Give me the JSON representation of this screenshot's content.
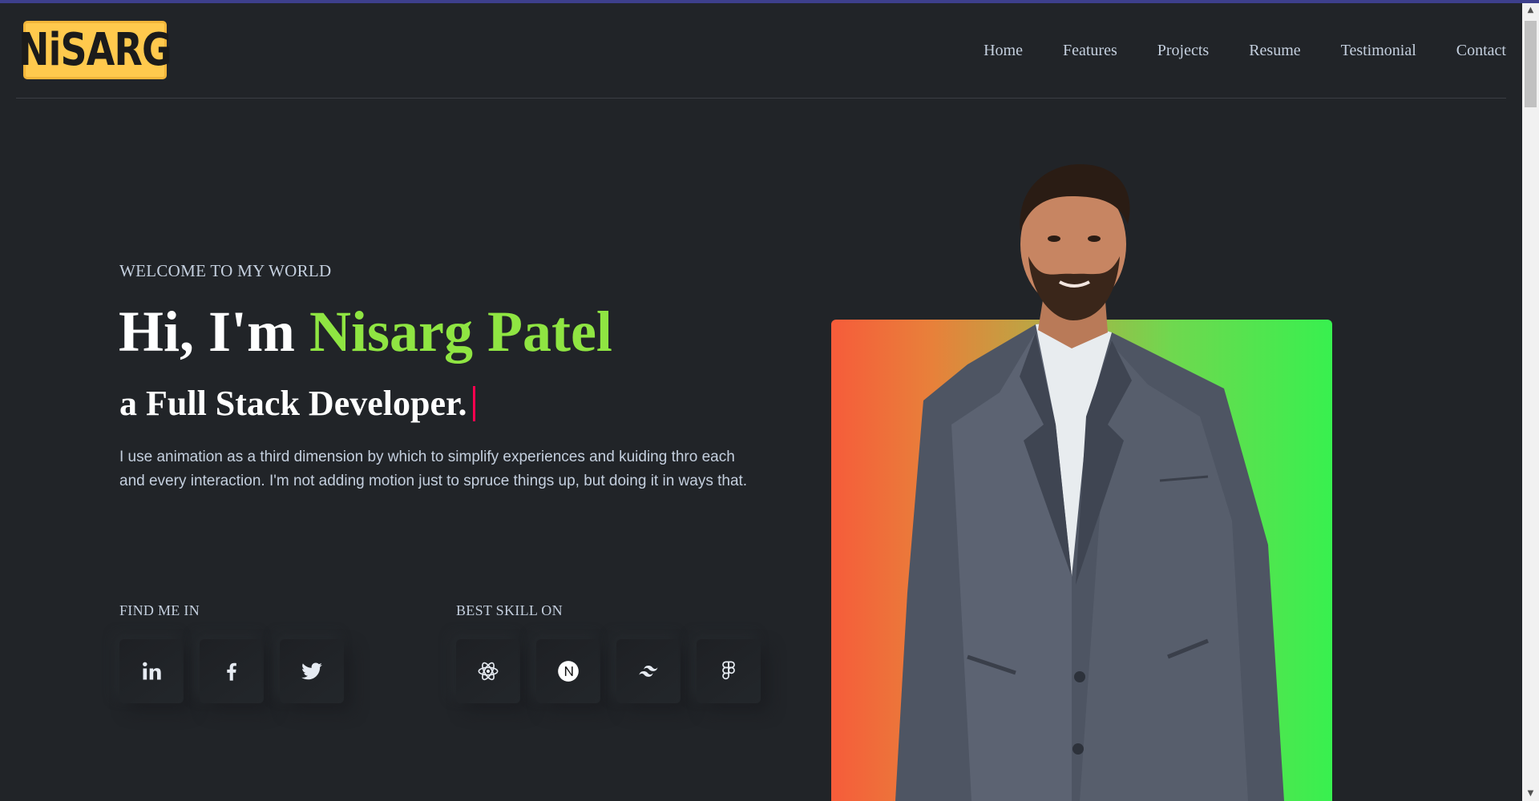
{
  "header": {
    "logo_text": "NiSARG",
    "nav": [
      "Home",
      "Features",
      "Projects",
      "Resume",
      "Testimonial",
      "Contact"
    ]
  },
  "hero": {
    "welcome": "WELCOME TO MY WORLD",
    "greeting": "Hi, I'm ",
    "name": "Nisarg Patel",
    "role": "a Full Stack Developer.",
    "description": "I use animation as a third dimension by which to simplify experiences and kuiding thro each and every interaction. I'm not adding motion just to spruce things up, but doing it in ways that."
  },
  "social": {
    "label": "FIND ME IN",
    "icons": [
      "linkedin-icon",
      "facebook-icon",
      "twitter-icon"
    ]
  },
  "skills": {
    "label": "BEST SKILL ON",
    "icons": [
      "react-icon",
      "nextjs-icon",
      "tailwind-icon",
      "figma-icon"
    ]
  },
  "colors": {
    "background": "#212428",
    "accent_name": "#8fe542",
    "cursor": "#ff014f",
    "logo_bg": "#ffc94d",
    "photo_gradient_start": "#f65c3a",
    "photo_gradient_end": "#38f04f"
  }
}
